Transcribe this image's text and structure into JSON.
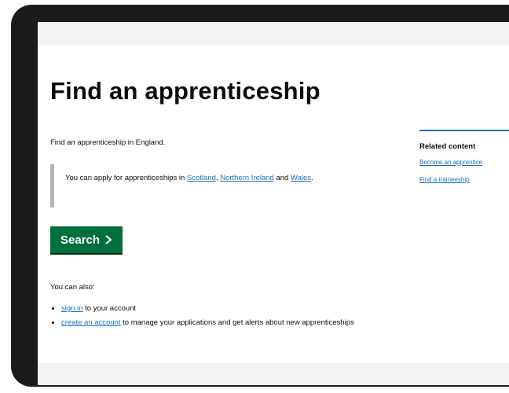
{
  "page": {
    "title": "Find an apprenticeship",
    "lead": "Find an apprenticeship in England.",
    "inset": {
      "prefix": "You can apply for apprenticeships in ",
      "link_scotland": "Scotland",
      "sep1": ", ",
      "link_northern_ireland": "Northern Ireland",
      "sep2": " and ",
      "link_wales": "Wales",
      "suffix": "."
    },
    "search_button": "Search",
    "also_heading": "You can also:",
    "options": {
      "sign_in_link": "sign in",
      "sign_in_rest": " to your account",
      "create_link": "create an account",
      "create_rest": " to manage your applications and get alerts about new apprenticeships"
    }
  },
  "related": {
    "heading": "Related content",
    "links": [
      "Become an apprentice",
      "Find a traineeship"
    ]
  },
  "colors": {
    "button_green": "#00703c",
    "link_blue": "#1d70b8",
    "inset_border": "#b1b4b6"
  },
  "icons": {
    "search_button_icon": "chevron-right-icon"
  }
}
